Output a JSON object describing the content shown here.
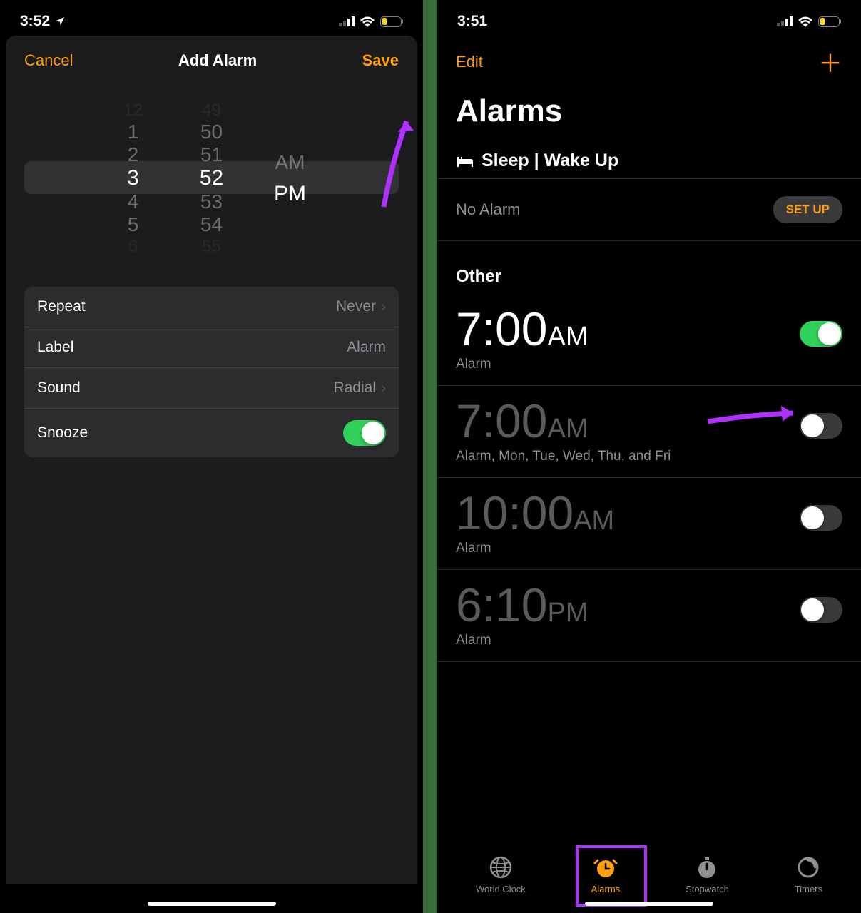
{
  "left": {
    "status": {
      "time": "3:52",
      "battery": "16"
    },
    "sheet": {
      "cancel": "Cancel",
      "title": "Add Alarm",
      "save": "Save"
    },
    "picker": {
      "hours": [
        "12",
        "1",
        "2",
        "3",
        "4",
        "5",
        "6"
      ],
      "minutes": [
        "49",
        "50",
        "51",
        "52",
        "53",
        "54",
        "55"
      ],
      "ampm": [
        "AM",
        "PM"
      ],
      "selected_hour": "3",
      "selected_minute": "52",
      "selected_ampm": "PM"
    },
    "settings": {
      "repeat_label": "Repeat",
      "repeat_value": "Never",
      "label_label": "Label",
      "label_value": "Alarm",
      "sound_label": "Sound",
      "sound_value": "Radial",
      "snooze_label": "Snooze",
      "snooze_on": true
    }
  },
  "right": {
    "status": {
      "time": "3:51",
      "battery": "17"
    },
    "edit": "Edit",
    "page_title": "Alarms",
    "sleep_section": "Sleep | Wake Up",
    "no_alarm": "No Alarm",
    "setup": "SET UP",
    "other_section": "Other",
    "alarms": [
      {
        "time": "7:00",
        "ampm": "AM",
        "label": "Alarm",
        "on": true
      },
      {
        "time": "7:00",
        "ampm": "AM",
        "label": "Alarm, Mon, Tue, Wed, Thu, and Fri",
        "on": false
      },
      {
        "time": "10:00",
        "ampm": "AM",
        "label": "Alarm",
        "on": false
      },
      {
        "time": "6:10",
        "ampm": "PM",
        "label": "Alarm",
        "on": false
      }
    ],
    "tabs": {
      "world_clock": "World Clock",
      "alarms": "Alarms",
      "stopwatch": "Stopwatch",
      "timers": "Timers"
    }
  }
}
